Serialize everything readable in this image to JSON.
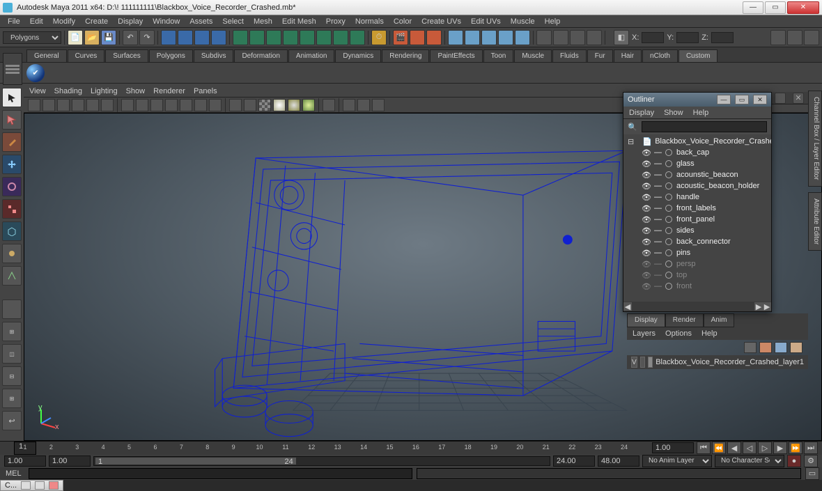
{
  "titlebar": {
    "title": "Autodesk Maya 2011 x64: D:\\! 111111111\\Blackbox_Voice_Recorder_Crashed.mb*"
  },
  "menu": [
    "File",
    "Edit",
    "Modify",
    "Create",
    "Display",
    "Window",
    "Assets",
    "Select",
    "Mesh",
    "Edit Mesh",
    "Proxy",
    "Normals",
    "Color",
    "Create UVs",
    "Edit UVs",
    "Muscle",
    "Help"
  ],
  "mode": "Polygons",
  "xyz": {
    "x": "X:",
    "y": "Y:",
    "z": "Z:"
  },
  "shelf_tabs": [
    "General",
    "Curves",
    "Surfaces",
    "Polygons",
    "Subdivs",
    "Deformation",
    "Animation",
    "Dynamics",
    "Rendering",
    "PaintEffects",
    "Toon",
    "Muscle",
    "Fluids",
    "Fur",
    "Hair",
    "nCloth",
    "Custom"
  ],
  "shelf_active": "Custom",
  "viewport_menu": [
    "View",
    "Shading",
    "Lighting",
    "Show",
    "Renderer",
    "Panels"
  ],
  "outliner": {
    "title": "Outliner",
    "menu": [
      "Display",
      "Show",
      "Help"
    ],
    "root": "Blackbox_Voice_Recorder_Crashed",
    "items": [
      {
        "name": "back_cap",
        "dim": false
      },
      {
        "name": "glass",
        "dim": false
      },
      {
        "name": "acounstic_beacon",
        "dim": false
      },
      {
        "name": "acoustic_beacon_holder",
        "dim": false
      },
      {
        "name": "handle",
        "dim": false
      },
      {
        "name": "front_labels",
        "dim": false
      },
      {
        "name": "front_panel",
        "dim": false
      },
      {
        "name": "sides",
        "dim": false
      },
      {
        "name": "back_connector",
        "dim": false
      },
      {
        "name": "pins",
        "dim": false
      },
      {
        "name": "persp",
        "dim": true
      },
      {
        "name": "top",
        "dim": true
      },
      {
        "name": "front",
        "dim": true
      }
    ]
  },
  "right": {
    "header_label": "Channel Box / Layer Editor",
    "tabs": [
      "Display",
      "Render",
      "Anim"
    ],
    "tabs_active": "Display",
    "menu": [
      "Layers",
      "Options",
      "Help"
    ],
    "layer": {
      "vis": "V",
      "name": "Blackbox_Voice_Recorder_Crashed_layer1"
    }
  },
  "timeline": {
    "ticks": [
      1,
      2,
      3,
      4,
      5,
      6,
      7,
      8,
      9,
      10,
      11,
      12,
      13,
      14,
      15,
      16,
      17,
      18,
      19,
      20,
      21,
      22,
      23,
      24
    ],
    "cursor": "1",
    "field_right": "1.00"
  },
  "range": {
    "start_outer": "1.00",
    "start": "1.00",
    "slider_start": "1",
    "slider_end": "24",
    "end": "24.00",
    "end_outer": "48.00",
    "anim_layer": "No Anim Layer",
    "char_set": "No Character Set"
  },
  "cmd": {
    "label": "MEL"
  },
  "taskbar": {
    "tab": "C..."
  }
}
